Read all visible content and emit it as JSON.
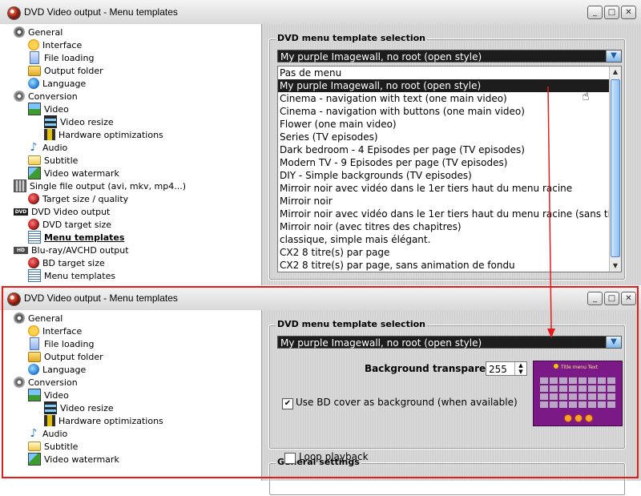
{
  "window_top": {
    "title": "DVD Video output - Menu templates",
    "buttons": [
      "_",
      "□",
      "✕"
    ]
  },
  "window_bottom": {
    "title": "DVD Video output - Menu templates",
    "buttons": [
      "_",
      "□",
      "✕"
    ]
  },
  "tree_top": [
    {
      "label": "General",
      "icon": "gear-icon"
    },
    {
      "label": "Interface",
      "icon": "smiley-icon"
    },
    {
      "label": "File loading",
      "icon": "page-icon"
    },
    {
      "label": "Output folder",
      "icon": "folder-icon"
    },
    {
      "label": "Language",
      "icon": "globe-icon"
    },
    {
      "label": "Conversion",
      "icon": "gear-icon"
    },
    {
      "label": "Video",
      "icon": "video-icon"
    },
    {
      "label": "Video resize",
      "icon": "film-icon"
    },
    {
      "label": "Hardware optimizations",
      "icon": "chip-icon"
    },
    {
      "label": "Audio",
      "icon": "music-note-icon"
    },
    {
      "label": "Subtitle",
      "icon": "subtitle-icon"
    },
    {
      "label": "Video watermark",
      "icon": "picture-icon"
    },
    {
      "label": "Single file output (avi, mkv, mp4...)",
      "icon": "film-strip-icon"
    },
    {
      "label": "Target size / quality",
      "icon": "target-icon"
    },
    {
      "label": "DVD Video output",
      "icon": "dvd-icon"
    },
    {
      "label": "DVD target size",
      "icon": "target-icon"
    },
    {
      "label": "Menu templates",
      "icon": "menu-icon"
    },
    {
      "label": "Blu-ray/AVCHD output",
      "icon": "hd-icon"
    },
    {
      "label": "BD target size",
      "icon": "target-icon"
    },
    {
      "label": "Menu templates",
      "icon": "menu-icon"
    }
  ],
  "tree_bottom": [
    {
      "label": "General",
      "icon": "gear-icon"
    },
    {
      "label": "Interface",
      "icon": "smiley-icon"
    },
    {
      "label": "File loading",
      "icon": "page-icon"
    },
    {
      "label": "Output folder",
      "icon": "folder-icon"
    },
    {
      "label": "Language",
      "icon": "globe-icon"
    },
    {
      "label": "Conversion",
      "icon": "gear-icon"
    },
    {
      "label": "Video",
      "icon": "video-icon"
    },
    {
      "label": "Video resize",
      "icon": "film-icon"
    },
    {
      "label": "Hardware optimizations",
      "icon": "chip-icon"
    },
    {
      "label": "Audio",
      "icon": "music-note-icon"
    },
    {
      "label": "Subtitle",
      "icon": "subtitle-icon"
    },
    {
      "label": "Video watermark",
      "icon": "picture-icon"
    }
  ],
  "template_group": {
    "label": "DVD menu template selection",
    "selected": "My purple  Imagewall, no root (open style)"
  },
  "dropdown_options": [
    "Pas de menu",
    "My purple  Imagewall, no root (open style)",
    "Cinema - navigation with text (one main video)",
    "Cinema - navigation with buttons (one main video)",
    "Flower (one main video)",
    "Series (TV episodes)",
    "Dark bedroom - 4 Episodes per page  (TV episodes)",
    "Modern TV - 9 Episodes per page (TV episodes)",
    "DIY - Simple backgrounds (TV episodes)",
    "Mirroir noir avec vidéo dans le 1er tiers haut du menu racine",
    "Mirroir noir",
    "Mirroir noir avec vidéo dans le 1er tiers haut du menu racine (sans titres de",
    "Mirroir noir (avec titres des chapitres)",
    "classique, simple mais élégant.",
    "CX2 8 titre(s) par page",
    "CX2 8 titre(s) par page, sans animation de fondu"
  ],
  "bottom_panel": {
    "background_transparency_label": "Background transparency",
    "background_transparency_value": "255",
    "use_bd_cover_label": "Use BD cover as background (when available)",
    "use_bd_cover_checked": true,
    "general_settings_label": "General settings",
    "loop_playback_label": "Loop playback",
    "loop_playback_checked": false,
    "preview_title": "Title menu Text"
  },
  "colors": {
    "highlight": "#1d1d1d",
    "annotation_red": "#e51b1b",
    "preview_purple": "#7b1a86"
  }
}
